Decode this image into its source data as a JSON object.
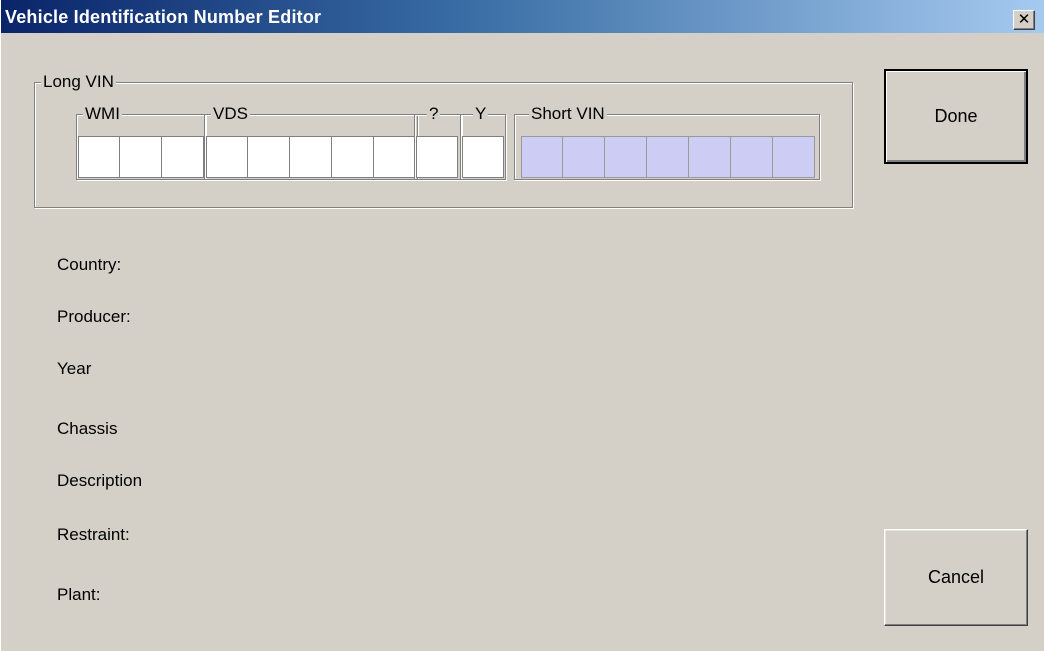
{
  "window": {
    "title": "Vehicle Identification Number Editor",
    "close_symbol": "✕"
  },
  "long_vin": {
    "label": "Long VIN",
    "groups": [
      {
        "label": "WMI",
        "cells": 3
      },
      {
        "label": "VDS",
        "cells": 5
      },
      {
        "label": "?",
        "cells": 1
      },
      {
        "label": "Y",
        "cells": 1
      },
      {
        "label": "Short VIN",
        "cells": 7
      }
    ]
  },
  "fields": {
    "country": "Country:",
    "producer": "Producer:",
    "year": "Year",
    "chassis": "Chassis",
    "description": "Description",
    "restraint": "Restraint:",
    "plant": "Plant:"
  },
  "buttons": {
    "done": "Done",
    "cancel": "Cancel"
  },
  "colors": {
    "short_vin_cell": "#ccccf5",
    "title_start": "#0a246a",
    "title_end": "#a6caf0"
  }
}
